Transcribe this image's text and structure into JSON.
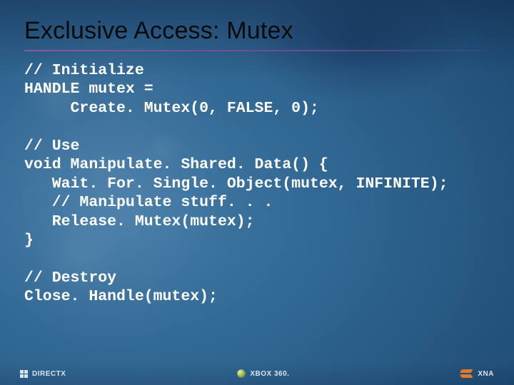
{
  "title": "Exclusive Access: Mutex",
  "code": "// Initialize\nHANDLE mutex =\n     Create. Mutex(0, FALSE, 0);\n\n// Use\nvoid Manipulate. Shared. Data() {\n   Wait. For. Single. Object(mutex, INFINITE);\n   // Manipulate stuff. . .\n   Release. Mutex(mutex);\n}\n\n// Destroy\nClose. Handle(mutex);",
  "footer": {
    "left": "DIRECTX",
    "center": "XBOX 360.",
    "right": "XNA"
  }
}
